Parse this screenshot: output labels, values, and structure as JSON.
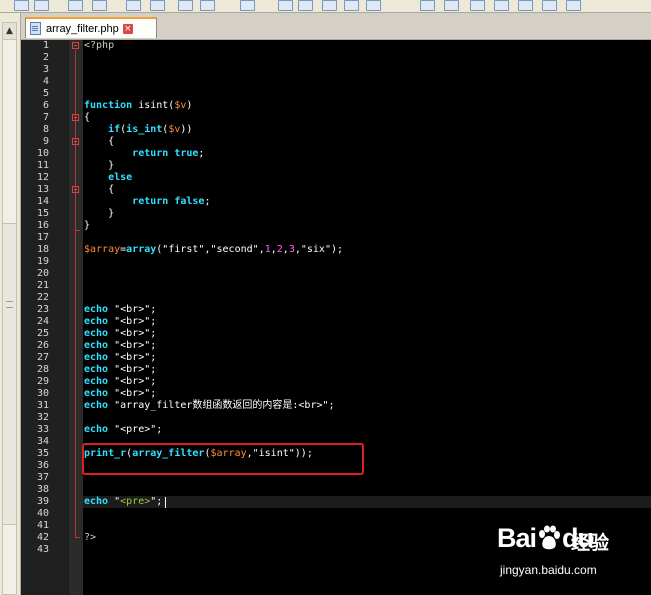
{
  "tab": {
    "filename": "array_filter.php",
    "close_glyph": "×"
  },
  "gutter": {
    "line_numbers": [
      "1",
      "2",
      "3",
      "4",
      "5",
      "6",
      "7",
      "8",
      "9",
      "10",
      "11",
      "12",
      "13",
      "14",
      "15",
      "16",
      "17",
      "18",
      "19",
      "20",
      "21",
      "22",
      "23",
      "24",
      "25",
      "26",
      "27",
      "28",
      "29",
      "30",
      "31",
      "32",
      "33",
      "34",
      "35",
      "36",
      "37",
      "38",
      "39",
      "40",
      "41",
      "42",
      "43"
    ]
  },
  "code": {
    "l1": "<?php",
    "l6_kw": "function",
    "l6_name": " isint(",
    "l6_var": "$v",
    "l6_end": ")",
    "l7": "{",
    "l8_kw": "if",
    "l8_open": "(",
    "l8_fn": "is_int",
    "l8_open2": "(",
    "l8_var": "$v",
    "l8_close": "))",
    "l9": "{",
    "l10_kw": "return",
    "l10_val": "true",
    "l10_end": ";",
    "l11": "}",
    "l12_kw": "else",
    "l13": "{",
    "l14_kw": "return",
    "l14_val": "false",
    "l14_end": ";",
    "l15": "}",
    "l16": "}",
    "l18_var": "$array",
    "l18_eq": "=",
    "l18_fn": "array",
    "l18_open": "(",
    "l18_s1": "\"first\"",
    "l18_c1": ",",
    "l18_s2": "\"second\"",
    "l18_c2": ",",
    "l18_n1": "1",
    "l18_c3": ",",
    "l18_n2": "2",
    "l18_c4": ",",
    "l18_n3": "3",
    "l18_c5": ",",
    "l18_s3": "\"six\"",
    "l18_close": ");",
    "echo_kw": "echo",
    "echo_br": " \"<br>\";",
    "l31_str": " \"array_filter数组函数返回的内容是:<br>\";",
    "l33_str": " \"<pre>\";",
    "l35_fn": "print_r",
    "l35_open": "(",
    "l35_fn2": "array_filter",
    "l35_open2": "(",
    "l35_var": "$array",
    "l35_comma": ",",
    "l35_str": "\"isint\"",
    "l35_close": "));",
    "l39_q1": " \"",
    "l39_tag": "<pre>",
    "l39_q2": "\";",
    "l42": "?>"
  },
  "watermark": {
    "logo": "Bai",
    "logo_suffix": "du",
    "service": "经验",
    "url": "jingyan.baidu.com"
  }
}
